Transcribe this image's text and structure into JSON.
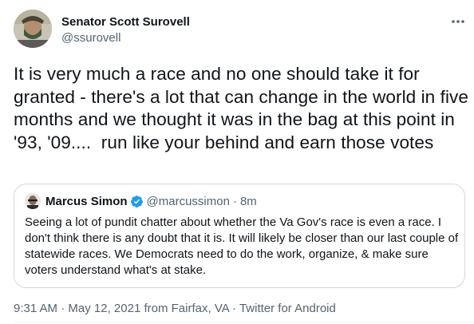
{
  "author": {
    "name": "Senator Scott Surovell",
    "handle": "@ssurovell",
    "avatar_icon": "profile-photo-icon"
  },
  "tweet": {
    "text": "It is very much a race and no one should take it for granted - there's a lot that can change in the world in five months and we thought it was in the bag at this point in '93, '09....  run like your behind and earn those votes"
  },
  "quote": {
    "name": "Marcus Simon",
    "handle": "@marcussimon",
    "separator": "·",
    "time": "8m",
    "text": "Seeing a lot of pundit chatter about whether the Va Gov's race is even a race. I don't think there is any doubt that it is. It will likely be closer than our last couple of statewide races. We Democrats need to do the work, organize, & make sure voters understand what's at stake."
  },
  "meta": {
    "time": "9:31 AM",
    "sep1": " · ",
    "date": "May 12, 2021",
    "from": " from ",
    "place": "Fairfax, VA",
    "sep2": " · ",
    "client": "Twitter for Android"
  },
  "colors": {
    "text": "#0f1419",
    "secondary": "#536471",
    "verified": "#1d9bf0",
    "border": "#cfd9de"
  }
}
